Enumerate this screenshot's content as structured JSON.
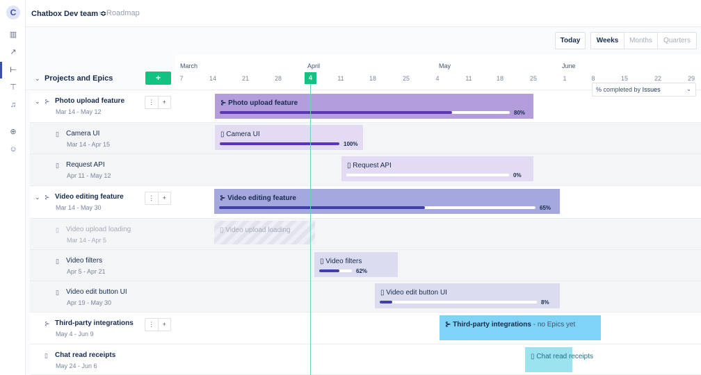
{
  "rail": {
    "avatar_letter": "C",
    "icons": [
      "board-icon",
      "reports-icon",
      "roadmap-icon",
      "pin-icon",
      "bell-icon",
      "add-icon",
      "add-user-icon"
    ]
  },
  "breadcrumb": {
    "team": "Chatbox Dev team ≎",
    "separator": "›",
    "page": "Roadmap"
  },
  "toolbar": {
    "today": "Today",
    "weeks": "Weeks",
    "months": "Months",
    "quarters": "Quarters"
  },
  "left_header": {
    "title": "Projects and Epics",
    "add_label": "+"
  },
  "timeline_header": {
    "months": [
      "March",
      "April",
      "May",
      "June"
    ],
    "days": [
      "7",
      "14",
      "21",
      "28",
      "4",
      "11",
      "18",
      "25",
      "4",
      "11",
      "18",
      "25",
      "1",
      "8",
      "15",
      "22",
      "29"
    ],
    "today_day": "4"
  },
  "progress_selector": {
    "prefix": "% completed by",
    "value": "Issues"
  },
  "rows": [
    {
      "type": "epic",
      "name": "Photo upload feature",
      "dates": "Mar 14 - May 12",
      "bar_label": "Photo upload feature",
      "progress": 0.8,
      "pct_label": "80%"
    },
    {
      "type": "issue",
      "name": "Camera UI",
      "dates": "Mar 14 - Apr 15",
      "bar_label": "Camera UI",
      "progress": 1.0,
      "pct_label": "100%"
    },
    {
      "type": "issue",
      "name": "Request API",
      "dates": "Apr 11 - May 12",
      "bar_label": "Request API",
      "progress": 0.0,
      "pct_label": "0%"
    },
    {
      "type": "epic",
      "name": "Video editing feature",
      "dates": "Mar 14 - May 30",
      "bar_label": "Video editing feature",
      "progress": 0.65,
      "pct_label": "65%"
    },
    {
      "type": "ghost",
      "name": "Video upload loading",
      "dates": "Mar 14 - Apr 5",
      "bar_label": "Video upload loading"
    },
    {
      "type": "issue",
      "name": "Video filters",
      "dates": "Apr 5 - Apr 21",
      "bar_label": "Video filters",
      "progress": 0.62,
      "pct_label": "62%"
    },
    {
      "type": "issue",
      "name": "Video edit button UI",
      "dates": "Apr 19 - May 30",
      "bar_label": "Video edit button UI",
      "progress": 0.08,
      "pct_label": "8%"
    },
    {
      "type": "project",
      "name": "Third-party integrations",
      "dates": "May 4 - Jun 9",
      "bar_label": "Third-party integrations",
      "bar_note": " - no Epics yet"
    },
    {
      "type": "standalone",
      "name": "Chat read receipts",
      "dates": "May 24 - Jun 6",
      "bar_label": "Chat read receipts"
    }
  ],
  "row_controls": {
    "more": "⋮",
    "add": "+"
  },
  "colors": {
    "epic1_bar": "#b39ddb",
    "epic1_fill": "#5e35b1",
    "issue1_bar": "#e3dbf3",
    "epic2_bar": "#a5a8dd",
    "epic2_fill": "#3f3fa8",
    "issue2_bar": "#dcdcf1",
    "project_bar": "#7fd3f7",
    "standalone_bar": "#9be3ef",
    "accent_green": "#13c281"
  }
}
